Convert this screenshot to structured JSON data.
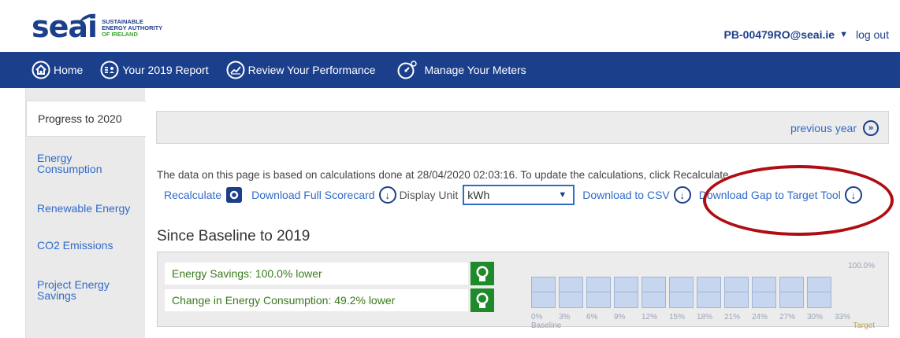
{
  "header": {
    "logo_word": "seai",
    "logo_line1": "SUSTAINABLE",
    "logo_line2": "ENERGY AUTHORITY",
    "logo_line3": "OF IRELAND",
    "user_email": "PB-00479RO@seai.ie",
    "logout": "log out"
  },
  "nav": {
    "items": [
      {
        "label": "Home",
        "icon": "home-icon"
      },
      {
        "label": "Your 2019 Report",
        "icon": "report-icon"
      },
      {
        "label": "Review Your Performance",
        "icon": "performance-chart-icon"
      },
      {
        "label": "Manage Your Meters",
        "icon": "meter-gauge-icon"
      }
    ]
  },
  "sidebar": {
    "items": [
      {
        "label": "Progress to 2020",
        "active": true
      },
      {
        "label": "Energy\nConsumption"
      },
      {
        "label": "Renewable Energy"
      },
      {
        "label": "CO2 Emissions"
      },
      {
        "label": "Project Energy\nSavings"
      }
    ]
  },
  "main": {
    "previous_year": "previous year",
    "info_text": "The data on this page is based on calculations done at 28/04/2020 02:03:16. To update the calculations, click Recalculate",
    "recalculate": "Recalculate",
    "download_scorecard": "Download Full Scorecard",
    "display_unit_label": "Display Unit",
    "display_unit_value": "kWh",
    "download_csv": "Download to CSV",
    "download_gap": "Download Gap to Target Tool",
    "section_title": "Since Baseline to 2019",
    "metrics": [
      {
        "label": "Energy Savings: 100.0% lower"
      },
      {
        "label": "Change in Energy Consumption: 49.2% lower"
      }
    ],
    "progress": {
      "value_label": "100.0%",
      "fraction": 0,
      "ticks": [
        "0%",
        "3%",
        "6%",
        "9%",
        "12%",
        "15%",
        "18%",
        "21%",
        "24%",
        "27%",
        "30%",
        "33%"
      ],
      "baseline_label": "Baseline",
      "target_label": "Target"
    }
  },
  "colors": {
    "brand_blue": "#1c3f8c",
    "link_blue": "#2f6bc9",
    "annotation_red": "#b00d12",
    "bulb_green": "#1f8a2b"
  }
}
